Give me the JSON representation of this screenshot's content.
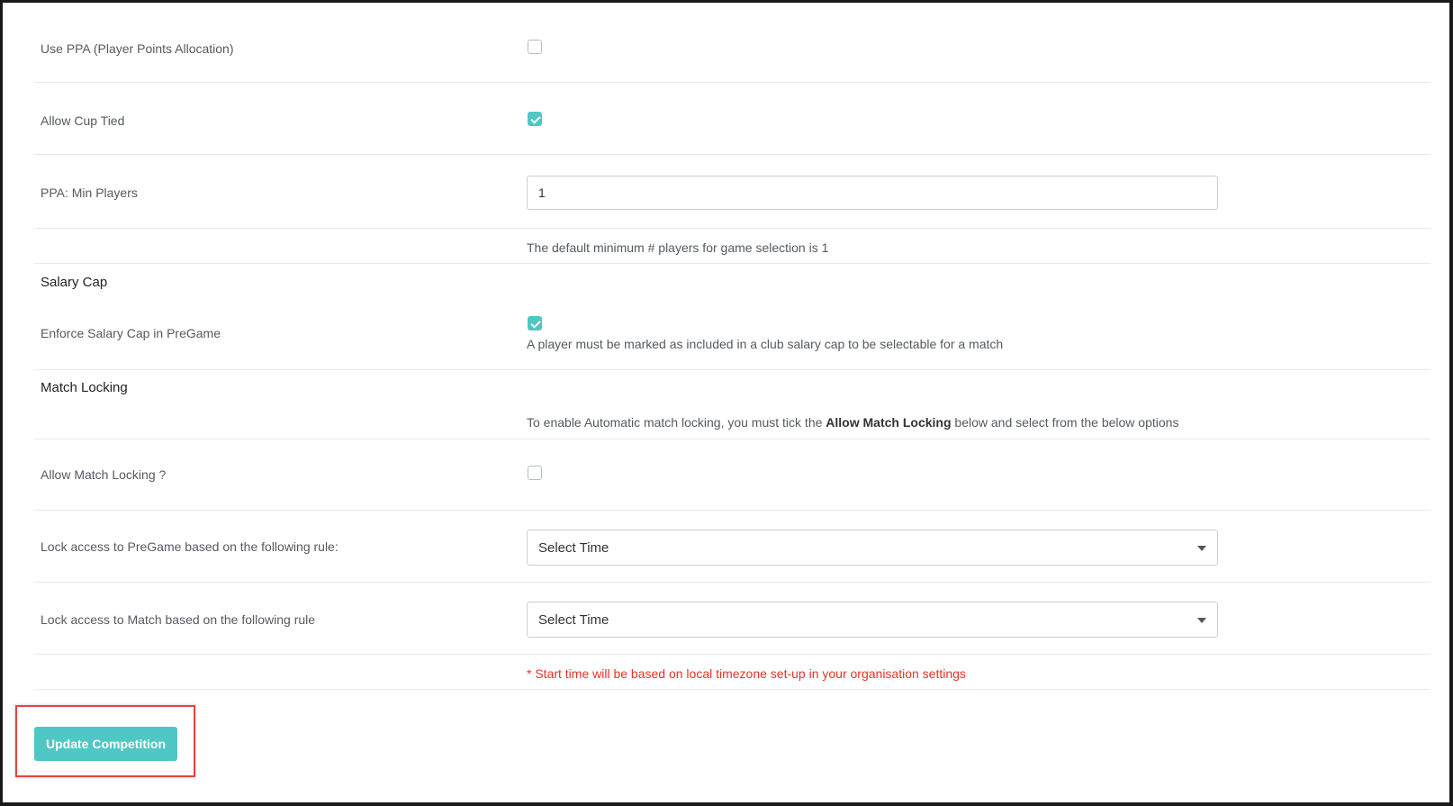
{
  "fields": {
    "use_ppa": {
      "label": "Use PPA (Player Points Allocation)",
      "checked": false
    },
    "allow_cup_tied": {
      "label": "Allow Cup Tied",
      "checked": true
    },
    "ppa_min_players": {
      "label": "PPA: Min Players",
      "value": "1",
      "help": "The default minimum # players for game selection is 1"
    }
  },
  "salary_cap": {
    "heading": "Salary Cap",
    "enforce": {
      "label": "Enforce Salary Cap in PreGame",
      "checked": true,
      "help": "A player must be marked as included in a club salary cap to be selectable for a match"
    }
  },
  "match_locking": {
    "heading": "Match Locking",
    "info_prefix": "To enable Automatic match locking, you must tick the",
    "info_bold": "Allow Match Locking",
    "info_suffix": "below and select from the below options",
    "allow": {
      "label": "Allow Match Locking ?",
      "checked": false
    },
    "pregame_rule": {
      "label": "Lock access to PreGame based on the following rule:",
      "value": "Select Time"
    },
    "match_rule": {
      "label": "Lock access to Match based on the following rule",
      "value": "Select Time"
    },
    "note": "* Start time will be based on local timezone set-up in your organisation settings"
  },
  "actions": {
    "submit_label": "Update Competition"
  },
  "colors": {
    "accent": "#4fc7c4",
    "note": "#e8322a",
    "highlight": "#e4473e"
  }
}
